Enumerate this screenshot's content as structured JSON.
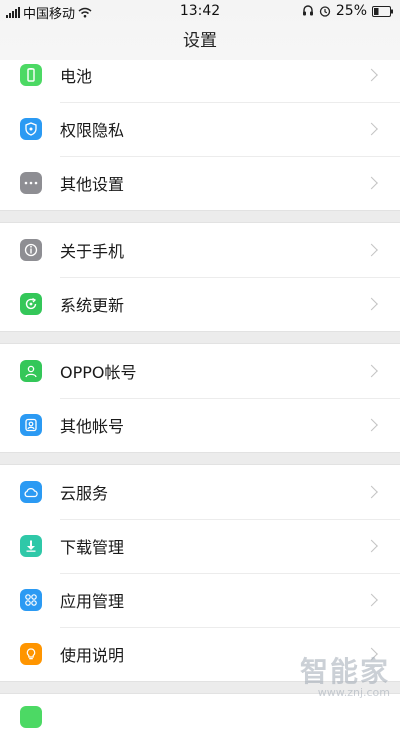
{
  "status_bar": {
    "carrier": "中国移动",
    "time": "13:42",
    "battery": "25%",
    "icons": [
      "signal-icon",
      "wifi-icon",
      "headset-icon",
      "alarm-icon",
      "battery-icon"
    ]
  },
  "title": "设置",
  "groups": [
    [
      {
        "label": "电池",
        "icon": "battery-icon",
        "color": "#4cd964"
      },
      {
        "label": "权限隐私",
        "icon": "shield-icon",
        "color": "#2b9af3"
      },
      {
        "label": "其他设置",
        "icon": "more-icon",
        "color": "#8e8e93"
      }
    ],
    [
      {
        "label": "关于手机",
        "icon": "info-icon",
        "color": "#8e8e93"
      },
      {
        "label": "系统更新",
        "icon": "update-icon",
        "color": "#34c759"
      }
    ],
    [
      {
        "label": "OPPO帐号",
        "icon": "person-icon",
        "color": "#34c759"
      },
      {
        "label": "其他帐号",
        "icon": "account-icon",
        "color": "#2b9af3"
      }
    ],
    [
      {
        "label": "云服务",
        "icon": "cloud-icon",
        "color": "#2b9af3"
      },
      {
        "label": "下载管理",
        "icon": "download-icon",
        "color": "#2fc8a8"
      },
      {
        "label": "应用管理",
        "icon": "apps-icon",
        "color": "#2b9af3"
      },
      {
        "label": "使用说明",
        "icon": "bulb-icon",
        "color": "#ff9500"
      }
    ]
  ],
  "watermark": {
    "main": "智能家",
    "sub": "www.znj.com"
  }
}
